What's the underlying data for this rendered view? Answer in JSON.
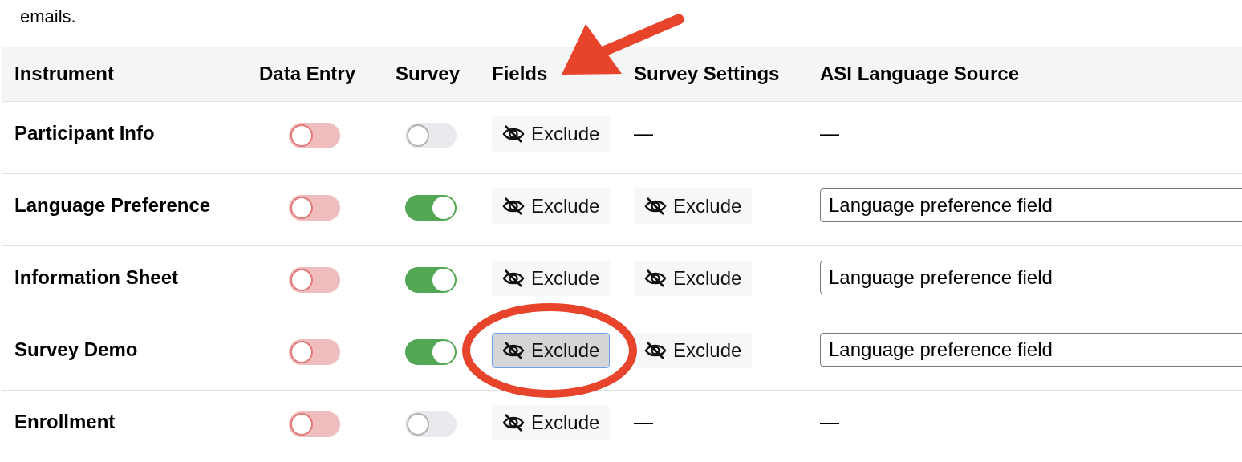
{
  "intro_text": "emails.",
  "columns": [
    "Instrument",
    "Data Entry",
    "Survey",
    "Fields",
    "Survey Settings",
    "ASI Language Source"
  ],
  "rows": [
    {
      "instrument": "Participant Info",
      "data_entry": {
        "on": false,
        "kind": "danger"
      },
      "survey": {
        "on": false,
        "kind": "normal"
      },
      "fields": {
        "label": "Exclude",
        "pressed": false
      },
      "survey_settings": {
        "kind": "none",
        "text": "—"
      },
      "asi_language_source": {
        "kind": "none",
        "text": "—"
      }
    },
    {
      "instrument": "Language Preference",
      "data_entry": {
        "on": false,
        "kind": "danger"
      },
      "survey": {
        "on": true,
        "kind": "normal"
      },
      "fields": {
        "label": "Exclude",
        "pressed": false
      },
      "survey_settings": {
        "kind": "button",
        "text": "Exclude"
      },
      "asi_language_source": {
        "kind": "select",
        "text": "Language preference field"
      }
    },
    {
      "instrument": "Information Sheet",
      "data_entry": {
        "on": false,
        "kind": "danger"
      },
      "survey": {
        "on": true,
        "kind": "normal"
      },
      "fields": {
        "label": "Exclude",
        "pressed": false
      },
      "survey_settings": {
        "kind": "button",
        "text": "Exclude"
      },
      "asi_language_source": {
        "kind": "select",
        "text": "Language preference field"
      }
    },
    {
      "instrument": "Survey Demo",
      "data_entry": {
        "on": false,
        "kind": "danger"
      },
      "survey": {
        "on": true,
        "kind": "normal"
      },
      "fields": {
        "label": "Exclude",
        "pressed": true
      },
      "survey_settings": {
        "kind": "button",
        "text": "Exclude"
      },
      "asi_language_source": {
        "kind": "select",
        "text": "Language preference field"
      }
    },
    {
      "instrument": "Enrollment",
      "data_entry": {
        "on": false,
        "kind": "danger"
      },
      "survey": {
        "on": false,
        "kind": "normal"
      },
      "fields": {
        "label": "Exclude",
        "pressed": false
      },
      "survey_settings": {
        "kind": "none",
        "text": "—"
      },
      "asi_language_source": {
        "kind": "none",
        "text": "—"
      }
    }
  ]
}
